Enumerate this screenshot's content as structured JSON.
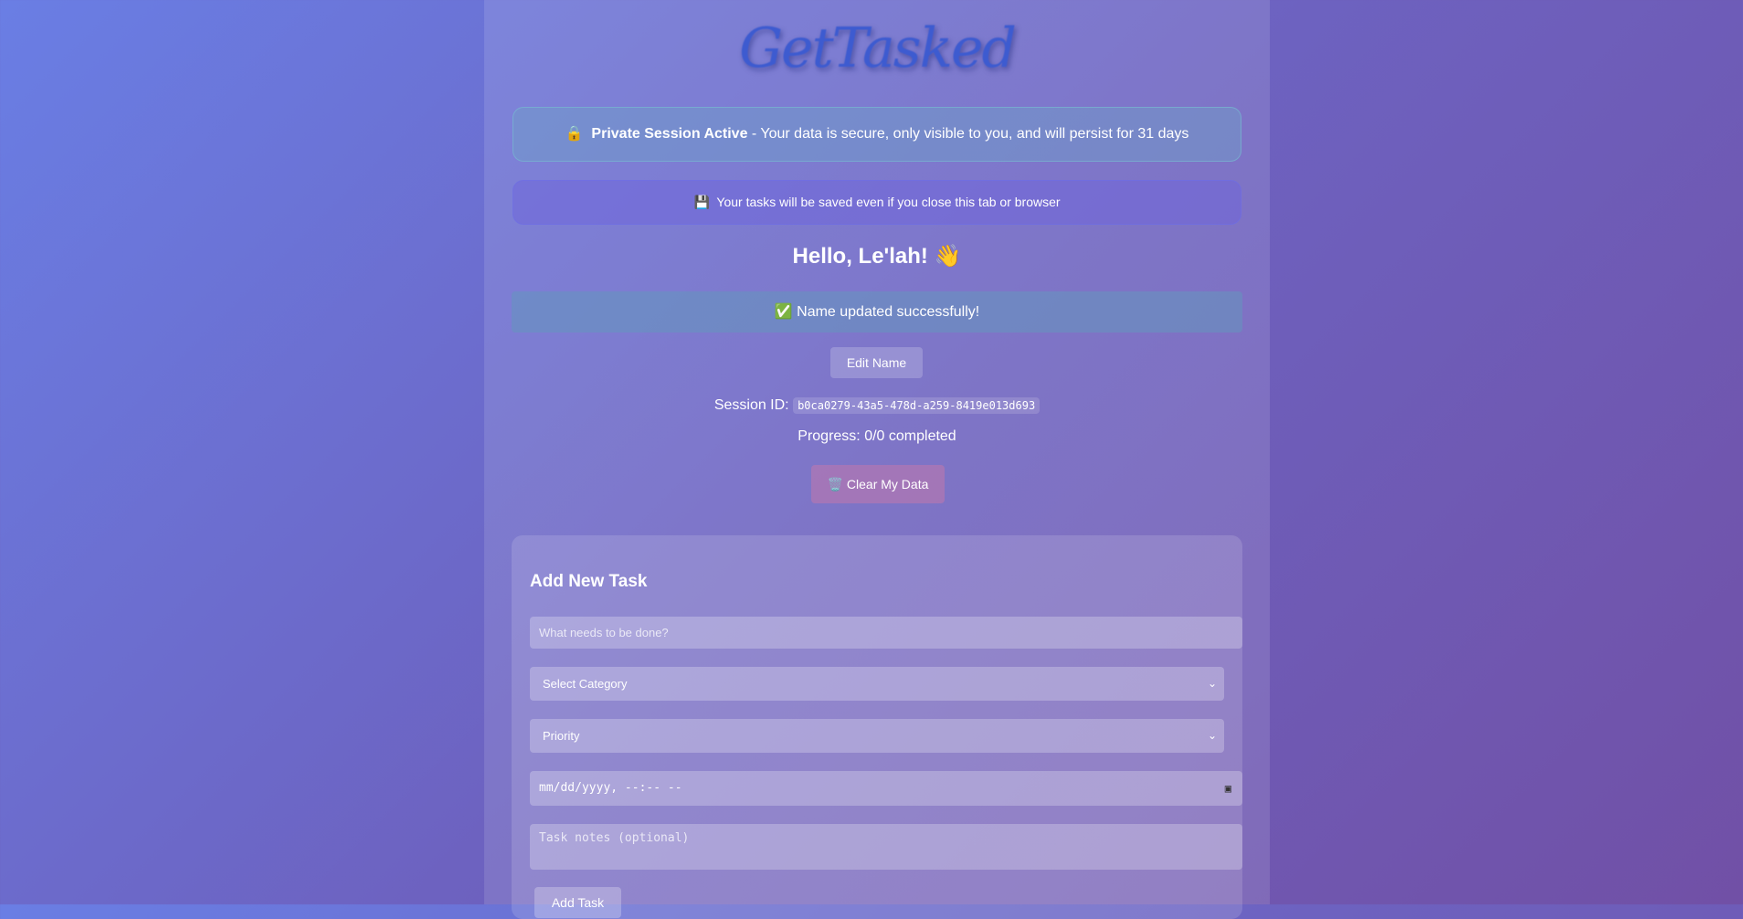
{
  "app": {
    "title": "GetTasked"
  },
  "banners": {
    "private_icon": "lock-icon",
    "private_bold": "Private Session Active",
    "private_text": " - Your data is secure, only visible to you, and will persist for 31 days",
    "saved_icon": "floppy-disk-icon",
    "saved_text": "Your tasks will be saved even if you close this tab or browser"
  },
  "greeting": "Hello, Le'lah! 👋",
  "success": "✅ Name updated successfully!",
  "edit_name": "Edit Name",
  "session": {
    "label": "Session ID:",
    "id": "b0ca0279-43a5-478d-a259-8419e013d693"
  },
  "progress": "Progress: 0/0 completed",
  "clear_data": "🗑️ Clear My Data",
  "form": {
    "title": "Add New Task",
    "task_placeholder": "What needs to be done?",
    "category": "Select Category",
    "priority": "Priority",
    "datetime_placeholder": "mm/dd/yyyy, --:-- --",
    "notes_placeholder": "Task notes (optional)",
    "add_button": "Add Task"
  }
}
